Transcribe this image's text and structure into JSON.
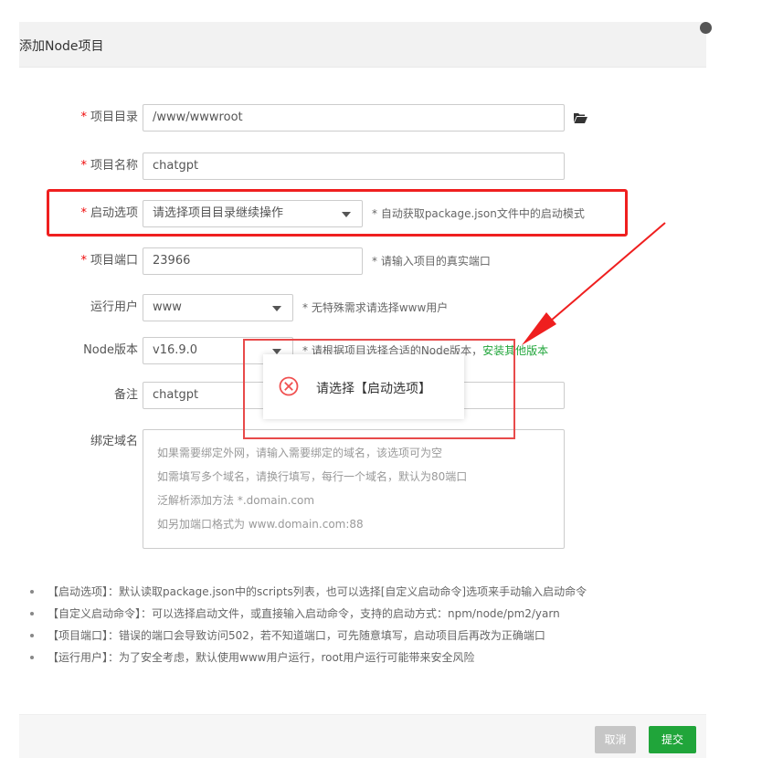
{
  "dialog": {
    "title": "添加Node项目"
  },
  "form": {
    "project_dir": {
      "label": "项目目录",
      "value": "/www/wwwroot"
    },
    "project_name": {
      "label": "项目名称",
      "value": "chatgpt"
    },
    "start_option": {
      "label": "启动选项",
      "value": "请选择项目目录继续操作",
      "hint": "* 自动获取package.json文件中的启动模式"
    },
    "project_port": {
      "label": "项目端口",
      "value": "23966",
      "hint": "* 请输入项目的真实端口"
    },
    "run_user": {
      "label": "运行用户",
      "value": "www",
      "hint": "* 无特殊需求请选择www用户"
    },
    "node_version": {
      "label": "Node版本",
      "value": "v16.9.0",
      "hint": "* 请根据项目选择合适的Node版本，",
      "link": "安装其他版本"
    },
    "remark": {
      "label": "备注",
      "value": "chatgpt"
    },
    "bind_domain": {
      "label": "绑定域名",
      "placeholder_lines": [
        "如果需要绑定外网，请输入需要绑定的域名，该选项可为空",
        "如需填写多个域名，请换行填写，每行一个域名，默认为80端口",
        "泛解析添加方法 *.domain.com",
        "如另加端口格式为 www.domain.com:88"
      ]
    }
  },
  "tips": [
    "【启动选项】：默认读取package.json中的scripts列表，也可以选择[自定义启动命令]选项来手动输入启动命令",
    "【自定义启动命令】：可以选择启动文件，或直接输入启动命令，支持的启动方式：npm/node/pm2/yarn",
    "【项目端口】：错误的端口会导致访问502，若不知道端口，可先随意填写，启动项目后再改为正确端口",
    "【运行用户】：为了安全考虑，默认使用www用户运行，root用户运行可能带来安全风险"
  ],
  "footer": {
    "cancel_label": "取消",
    "submit_label": "提交"
  },
  "toast": {
    "message": "请选择【启动选项】",
    "icon": "error-circle-icon"
  },
  "colors": {
    "accent": "#20a53a",
    "required": "#ef0808",
    "highlight": "#ef1f1f",
    "toast_icon": "#f05050"
  }
}
